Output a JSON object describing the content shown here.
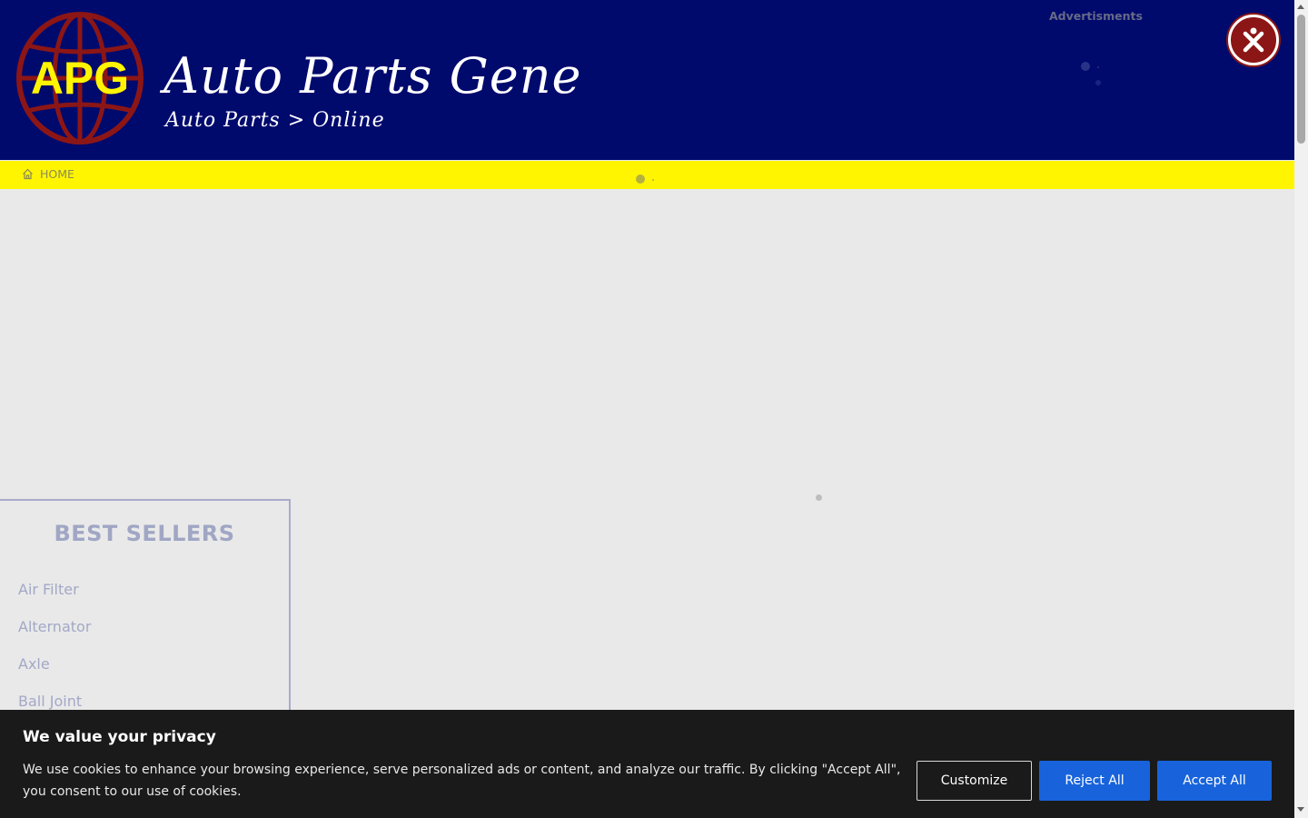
{
  "header": {
    "logo_text": "APG",
    "brand_title": "Auto Parts Gene",
    "brand_subtitle": "Auto Parts > Online",
    "ads_label": "Advertisments",
    "close_icon": "close-x-icon"
  },
  "nav": {
    "home_label": "HOME",
    "home_icon": "home-icon"
  },
  "best_sellers": {
    "title": "BEST SELLERS",
    "items": [
      "Air Filter",
      "Alternator",
      "Axle",
      "Ball Joint"
    ]
  },
  "cookie_banner": {
    "title": "We value your privacy",
    "text": "We use cookies to enhance your browsing experience, serve personalized ads or content, and analyze our traffic. By clicking \"Accept All\", you consent to our use of cookies.",
    "customize_label": "Customize",
    "reject_label": "Reject All",
    "accept_label": "Accept All"
  },
  "colors": {
    "header_bg": "#000a6d",
    "nav_bg": "#fff500",
    "logo_red": "#8c1616",
    "logo_yellow": "#fff500",
    "button_blue": "#1863dc",
    "banner_bg": "#1a1a1a"
  }
}
